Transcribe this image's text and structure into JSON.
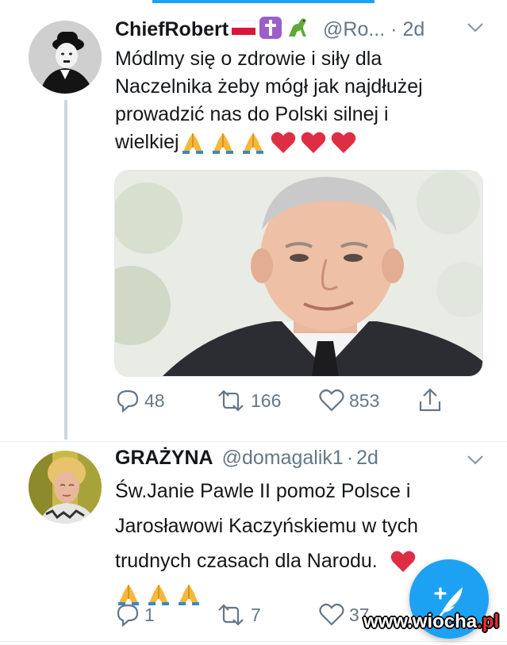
{
  "tweets": [
    {
      "name": "ChiefRobert",
      "handle": "@Ro...",
      "dot": "·",
      "time": "2d",
      "lines": [
        "Módlmy się o zdrowie i siły dla",
        "Naczelnika żeby mógł jak najdłużej",
        "prowadzić nas do Polski silnej i",
        "wielkiej"
      ],
      "name_badges": [
        "poland-flag-icon",
        "latin-cross-icon",
        "dinosaur-icon"
      ],
      "emojis": [
        "folded-hands-icon",
        "folded-hands-icon",
        "folded-hands-icon",
        "red-heart-icon",
        "red-heart-icon",
        "red-heart-icon"
      ],
      "replies": "48",
      "retweets": "166",
      "likes": "853"
    },
    {
      "name": "GRAŻYNA",
      "handle": "@domagalik1",
      "dot": "·",
      "time": "2d",
      "lines": [
        "Św.Janie Pawle II pomoż Polsce i",
        "Jarosławowi Kaczyńskiemu w tych",
        "trudnych czasach dla Narodu."
      ],
      "emojis_inline": [
        "red-heart-icon"
      ],
      "emojis_line": [
        "folded-hands-icon",
        "folded-hands-icon",
        "folded-hands-icon"
      ],
      "replies": "1",
      "retweets": "7",
      "likes": "37"
    }
  ],
  "watermark": {
    "main": "www.wiocha",
    "accent": ".pl"
  },
  "colors": {
    "brand": "#1da1f2",
    "muted": "#657786",
    "text": "#14171a",
    "heart": "#e0245e"
  }
}
